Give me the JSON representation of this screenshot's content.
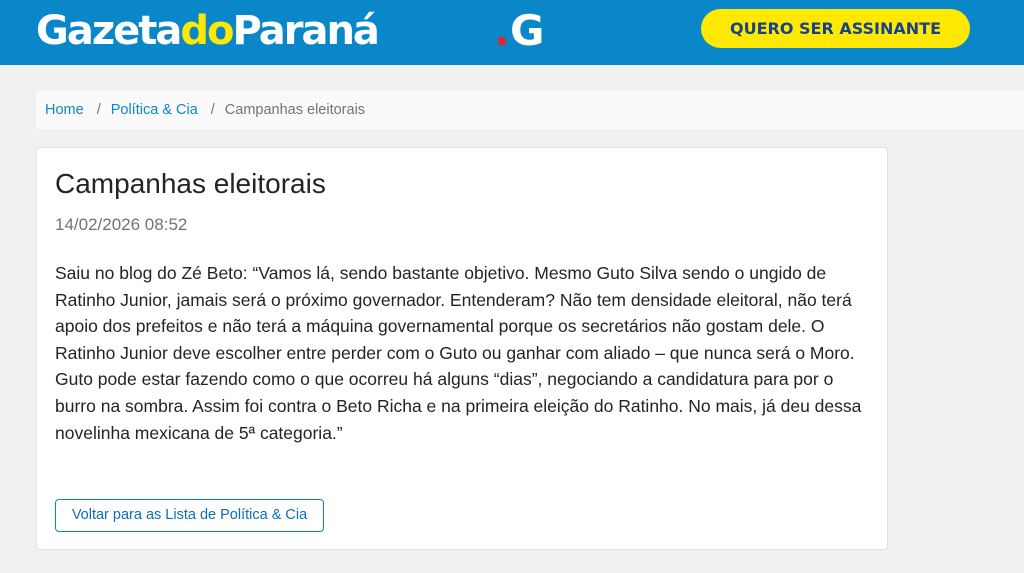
{
  "header": {
    "logo_part1": "Gazeta",
    "logo_part2": "do",
    "logo_part3": "Paraná",
    "g_mark_dot": ".",
    "g_mark_letter": "G",
    "cta_label": "QUERO SER ASSINANTE",
    "colors": {
      "bar": "#0a87c9",
      "accent": "#ffe900",
      "cta_text": "#16428a",
      "dot": "#e3262d"
    }
  },
  "breadcrumb": {
    "home": "Home",
    "section": "Política & Cia",
    "current": "Campanhas eleitorais",
    "separator": "/"
  },
  "article": {
    "title": "Campanhas eleitorais",
    "date": "14/02/2026 08:52",
    "body": "Saiu no blog do Zé Beto: “Vamos lá, sendo bastante objetivo. Mesmo Guto Silva sendo o ungido de Ratinho Junior, jamais será o próximo governador. Entenderam? Não tem densidade eleitoral, não terá apoio dos prefeitos e não terá a máquina governamental porque os secretários não gostam dele. O Ratinho Junior deve escolher entre perder com o Guto ou ganhar com aliado – que nunca será o Moro. Guto pode estar fazendo como o que ocorreu há alguns “dias”, negociando a candidatura para por o burro na sombra. Assim foi contra o Beto Richa e na primeira eleição do Ratinho. No mais, já deu dessa novelinha mexicana de 5ª categoria.”",
    "back_button": "Voltar para as Lista de Política & Cia"
  }
}
